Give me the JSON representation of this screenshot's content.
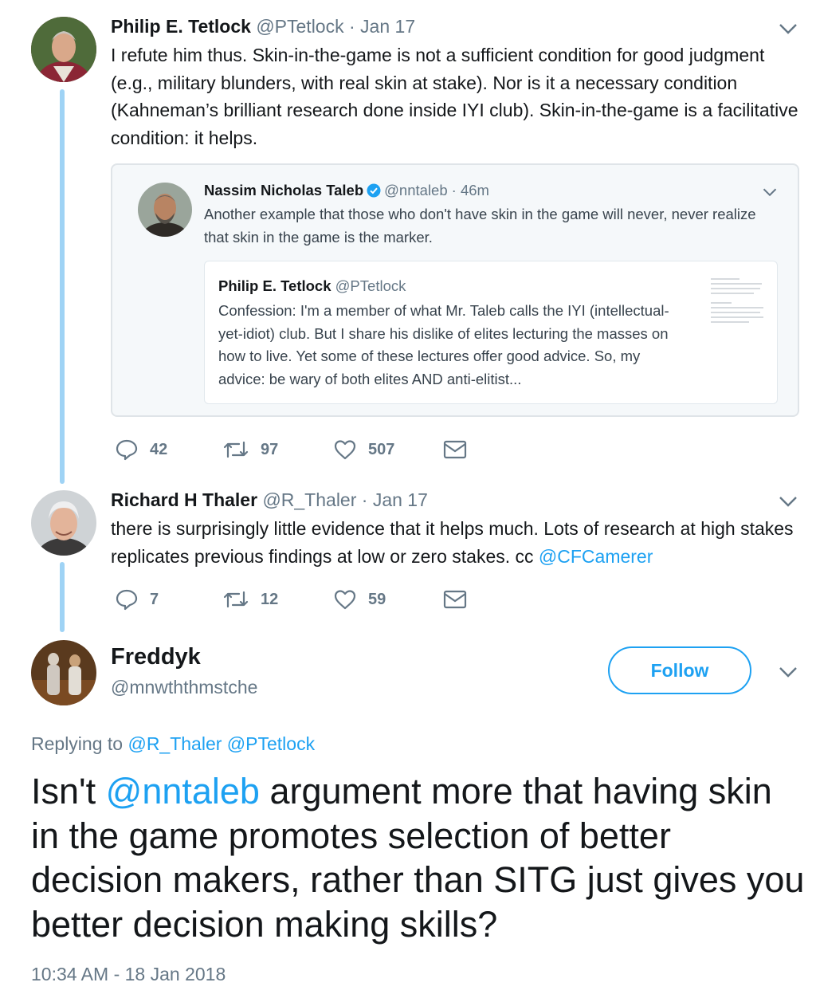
{
  "tweet1": {
    "name": "Philip E. Tetlock",
    "handle": "@PTetlock",
    "time": "· Jan 17",
    "text": "I refute him thus. Skin-in-the-game is not a sufficient condition for good judgment (e.g., military blunders, with real skin at stake). Nor is it a necessary condition (Kahneman’s brilliant research done inside IYI club). Skin-in-the-game is a facilitative condition: it helps.",
    "quoted": {
      "name": "Nassim Nicholas Taleb",
      "handle": "@nntaleb",
      "time": "· 46m",
      "text": "Another example that those who don't have skin in the game will never, never realize that skin in the game is the marker.",
      "nested": {
        "name": "Philip E. Tetlock",
        "handle": "@PTetlock",
        "text": "Confession: I'm a member of what Mr. Taleb calls the IYI (intellectual-yet-idiot) club. But I share his dislike of elites lecturing the masses on how to live. Yet some of these lectures offer good advice. So, my advice: be wary of both elites AND anti-elitist..."
      }
    },
    "replies": "42",
    "retweets": "97",
    "likes": "507"
  },
  "tweet2": {
    "name": "Richard H Thaler",
    "handle": "@R_Thaler",
    "time": "· Jan 17",
    "text": "there is surprisingly little evidence that it helps much. Lots of research at high stakes replicates previous findings at low or zero stakes.  cc ",
    "mention": "@CFCamerer",
    "replies": "7",
    "retweets": "12",
    "likes": "59"
  },
  "main": {
    "name": "Freddyk",
    "handle": "@mnwththmstche",
    "follow_label": "Follow",
    "replying_prefix": "Replying to ",
    "replying_handles": "@R_Thaler @PTetlock",
    "text_before": "Isn't ",
    "mention": "@nntaleb",
    "text_after": " argument more that having skin in the game promotes selection of better decision makers, rather than SITG just gives you better decision making skills?",
    "timestamp": "10:34 AM - 18 Jan 2018"
  },
  "colors": {
    "accent": "#1da1f2",
    "thread_line": "#9fd3f5",
    "muted": "#657786"
  }
}
